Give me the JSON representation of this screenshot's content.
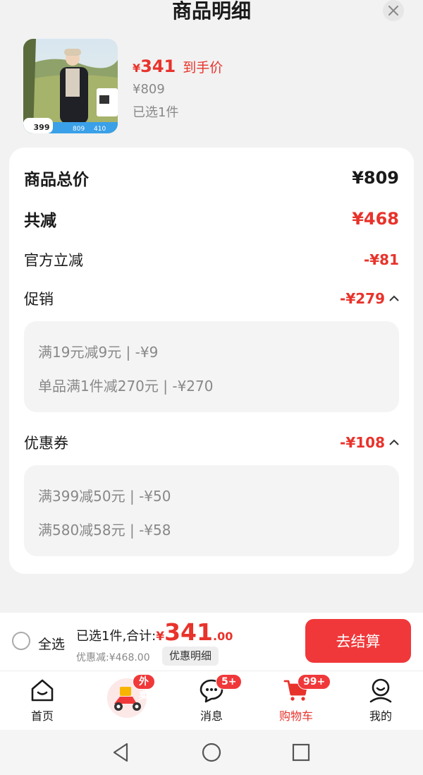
{
  "header": {
    "title": "商品明细"
  },
  "product": {
    "price_symbol": "¥",
    "price": "341",
    "price_tag": "到手价",
    "original_price": "¥809",
    "selected": "已选1件",
    "image_price_badge": "399",
    "image_prices": [
      "809",
      "410"
    ]
  },
  "breakdown": {
    "total_label": "商品总价",
    "total_value": "¥809",
    "reduce_label": "共减",
    "reduce_value": "¥468",
    "official_label": "官方立减",
    "official_value": "-¥81",
    "promo_label": "促销",
    "promo_value": "-¥279",
    "promo_items": [
      "满19元减9元 | -¥9",
      "单品满1件减270元 | -¥270"
    ],
    "coupon_label": "优惠券",
    "coupon_value": "-¥108",
    "coupon_items": [
      "满399减50元 | -¥50",
      "满580减58元 | -¥58"
    ]
  },
  "footer": {
    "select_all": "全选",
    "summary_prefix": "已选1件,合计:",
    "currency": "¥",
    "amount": "341",
    "decimal": ".00",
    "discount": "优惠减:¥468.00",
    "detail_chip": "优惠明细",
    "checkout": "去结算"
  },
  "tabs": [
    {
      "label": "首页",
      "icon": "home-icon"
    },
    {
      "label": "",
      "icon": "delivery-scooter-icon",
      "badge": "外卖"
    },
    {
      "label": "消息",
      "icon": "message-icon",
      "badge": "5+"
    },
    {
      "label": "购物车",
      "icon": "cart-icon",
      "badge": "99+",
      "active": true
    },
    {
      "label": "我的",
      "icon": "profile-icon"
    }
  ],
  "colors": {
    "accent": "#e8332b",
    "button": "#f0383a",
    "background": "#f2f2f2"
  }
}
